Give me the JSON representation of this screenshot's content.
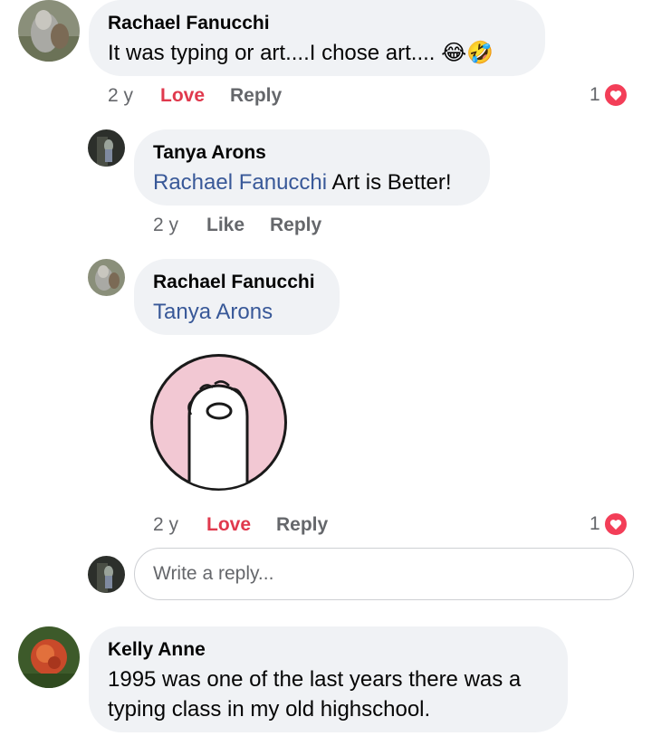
{
  "comments": [
    {
      "author": "Rachael Fanucchi",
      "text": "It was typing or art....I chose art....",
      "emoji": [
        "😂",
        "🤣"
      ],
      "age": "2 y",
      "action_reacted": "Love",
      "action_reply": "Reply",
      "reaction_count": "1"
    },
    {
      "author": "Tanya Arons",
      "mention": "Rachael Fanucchi",
      "text": "Art is Better!",
      "age": "2 y",
      "action_react": "Like",
      "action_reply": "Reply"
    },
    {
      "author": "Rachael Fanucchi",
      "mention": "Tanya Arons",
      "sticker": "paw-sticker",
      "age": "2 y",
      "action_reacted": "Love",
      "action_reply": "Reply",
      "reaction_count": "1"
    },
    {
      "author": "Kelly Anne",
      "text_line1": "1995 was one of the last years there was a",
      "text_line2": "typing class in my old highschool."
    }
  ],
  "reply_box": {
    "placeholder": "Write a reply..."
  },
  "colors": {
    "bubble": "#f0f2f5",
    "love": "#e0394d",
    "mention": "#385898",
    "muted": "#65676b"
  }
}
